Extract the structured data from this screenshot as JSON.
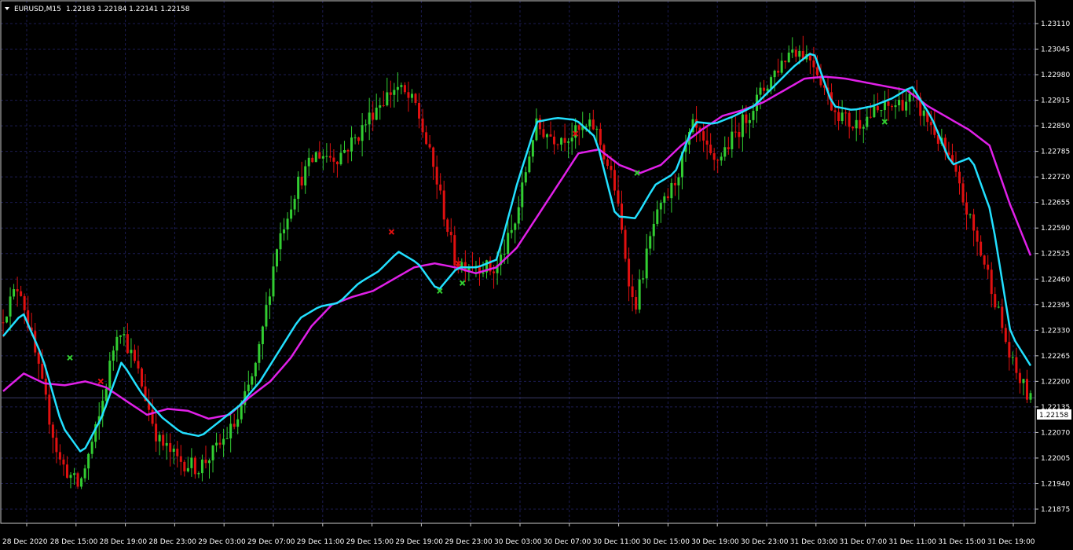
{
  "header": {
    "symbol": "EURUSD,M15",
    "ohlc": "1.22183 1.22184 1.22141 1.22158"
  },
  "current_price": "1.22158",
  "colors": {
    "background": "#000000",
    "grid": "#1c1c52",
    "frame": "#c8c8c8",
    "bull": "#32cd32",
    "bear": "#e01010",
    "fast_ma": "#22e0ff",
    "slow_ma": "#e020e8",
    "price_line": "#3a3a6a",
    "text": "#ffffff"
  },
  "chart_data": {
    "type": "line",
    "y_ticks": [
      "1.23110",
      "1.23045",
      "1.22980",
      "1.22915",
      "1.22850",
      "1.22785",
      "1.22720",
      "1.22655",
      "1.22590",
      "1.22525",
      "1.22460",
      "1.22395",
      "1.22330",
      "1.22265",
      "1.22200",
      "1.22135",
      "1.22070",
      "1.22005",
      "1.21940",
      "1.21875"
    ],
    "x_ticks": [
      "28 Dec 2020",
      "28 Dec 15:00",
      "28 Dec 19:00",
      "28 Dec 23:00",
      "29 Dec 03:00",
      "29 Dec 07:00",
      "29 Dec 11:00",
      "29 Dec 15:00",
      "29 Dec 19:00",
      "29 Dec 23:00",
      "30 Dec 03:00",
      "30 Dec 07:00",
      "30 Dec 11:00",
      "30 Dec 15:00",
      "30 Dec 19:00",
      "30 Dec 23:00",
      "31 Dec 03:00",
      "31 Dec 07:00",
      "31 Dec 11:00",
      "31 Dec 15:00",
      "31 Dec 19:00"
    ],
    "ylim": [
      1.21875,
      1.2311
    ],
    "grid": true,
    "price_path": [
      1.2235,
      1.2245,
      1.2222,
      1.22,
      1.2193,
      1.221,
      1.2235,
      1.2222,
      1.2205,
      1.22,
      1.2198,
      1.2203,
      1.221,
      1.2225,
      1.2255,
      1.227,
      1.2278,
      1.2277,
      1.2282,
      1.229,
      1.2295,
      1.229,
      1.2272,
      1.225,
      1.225,
      1.2248,
      1.226,
      1.2285,
      1.2282,
      1.2283,
      1.2285,
      1.227,
      1.2238,
      1.226,
      1.227,
      1.2285,
      1.2275,
      1.2282,
      1.229,
      1.2298,
      1.2305,
      1.2302,
      1.229,
      1.2285,
      1.2288,
      1.229,
      1.2292,
      1.2285,
      1.2275,
      1.226,
      1.2245,
      1.2225,
      1.2215
    ],
    "fast_ma": [
      1.22315,
      1.22375,
      1.2226,
      1.22085,
      1.22015,
      1.2211,
      1.2225,
      1.2217,
      1.2211,
      1.2207,
      1.2206,
      1.221,
      1.2214,
      1.222,
      1.2228,
      1.2236,
      1.2239,
      1.224,
      1.2245,
      1.2248,
      1.2253,
      1.225,
      1.2243,
      1.2249,
      1.2249,
      1.2251,
      1.227,
      1.2286,
      1.2287,
      1.22865,
      1.2282,
      1.2262,
      1.22615,
      1.227,
      1.2273,
      1.2286,
      1.22855,
      1.22875,
      1.229,
      1.2295,
      1.23,
      1.2304,
      1.229,
      1.2289,
      1.229,
      1.2292,
      1.2295,
      1.2287,
      1.2275,
      1.2277,
      1.2263,
      1.2232,
      1.2224
    ],
    "slow_ma": [
      1.22175,
      1.2222,
      1.22195,
      1.2219,
      1.222,
      1.22185,
      1.2215,
      1.22115,
      1.2213,
      1.22125,
      1.22105,
      1.22115,
      1.2216,
      1.222,
      1.2226,
      1.2234,
      1.22395,
      1.22415,
      1.2243,
      1.2246,
      1.2249,
      1.225,
      1.2249,
      1.22475,
      1.2249,
      1.2254,
      1.2262,
      1.227,
      1.2278,
      1.2279,
      1.2275,
      1.2273,
      1.2275,
      1.228,
      1.2284,
      1.22875,
      1.2289,
      1.2291,
      1.2294,
      1.2297,
      1.22975,
      1.2297,
      1.2296,
      1.2295,
      1.2294,
      1.229,
      1.2287,
      1.2284,
      1.228,
      1.2265,
      1.2252
    ],
    "markers": [
      {
        "series": "buy",
        "x": 0.065,
        "y": 1.2226
      },
      {
        "series": "sell",
        "x": 0.095,
        "y": 1.222
      },
      {
        "series": "sell",
        "x": 0.378,
        "y": 1.2258
      },
      {
        "series": "buy",
        "x": 0.425,
        "y": 1.2243
      },
      {
        "series": "sell",
        "x": 0.443,
        "y": 1.225
      },
      {
        "series": "buy",
        "x": 0.447,
        "y": 1.2245
      },
      {
        "series": "sell",
        "x": 0.557,
        "y": 1.2283
      },
      {
        "series": "buy",
        "x": 0.617,
        "y": 1.2273
      },
      {
        "series": "buy",
        "x": 0.858,
        "y": 1.2286
      }
    ]
  }
}
